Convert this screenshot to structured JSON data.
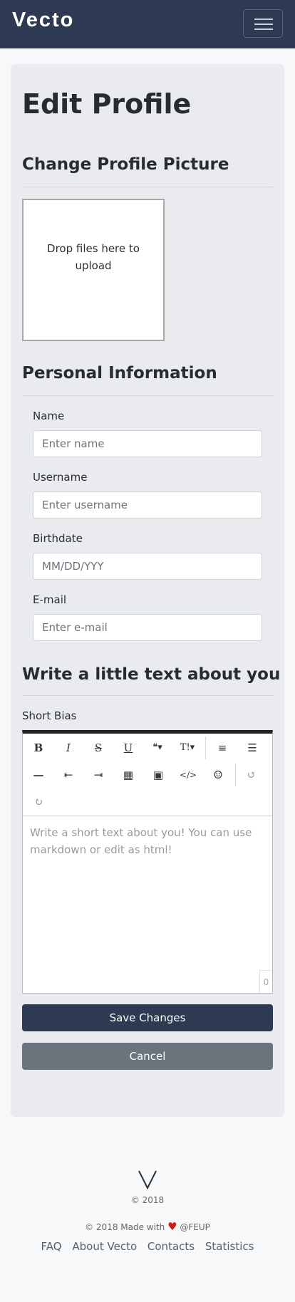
{
  "navbar": {
    "brand": "Vecto",
    "menu_icon": "hamburger-icon"
  },
  "page": {
    "title": "Edit Profile"
  },
  "picture_section": {
    "heading": "Change Profile Picture",
    "dropzone_text": "Drop files here to upload"
  },
  "personal_section": {
    "heading": "Personal Information",
    "fields": {
      "name": {
        "label": "Name",
        "placeholder": "Enter name"
      },
      "username": {
        "label": "Username",
        "placeholder": "Enter username"
      },
      "birthdate": {
        "label": "Birthdate",
        "placeholder": "MM/DD/YYY"
      },
      "email": {
        "label": "E-mail",
        "placeholder": "Enter e-mail"
      }
    }
  },
  "bio_section": {
    "heading": "Write a little text about you",
    "label": "Short Bias",
    "editor_placeholder": "Write a short text about you! You can use markdown or edit as html!",
    "char_count": "0",
    "toolbar": {
      "bold": "B",
      "italic": "I",
      "strike": "S",
      "underline": "U",
      "quote": "❝▾",
      "heading": "T!▾",
      "ordered_list": "≡",
      "bullet_list": "☰",
      "hr": "—",
      "outdent": "⇤",
      "indent": "⇥",
      "table": "▦",
      "image": "▣",
      "code": "</>",
      "emoji": "☺",
      "undo": "↺",
      "redo": "↻"
    }
  },
  "actions": {
    "save": "Save Changes",
    "cancel": "Cancel"
  },
  "footer": {
    "logo": "V",
    "copyright": "© 2018",
    "made_with_prefix": "© 2018 Made with",
    "heart": "♥",
    "made_with_suffix": "@FEUP",
    "links": [
      "FAQ",
      "About Vecto",
      "Contacts",
      "Statistics"
    ]
  },
  "colors": {
    "navbar": "#2d3a51",
    "primary_button": "#2d3a51",
    "secondary_button": "#6b737c",
    "heart": "#d11a1a"
  }
}
